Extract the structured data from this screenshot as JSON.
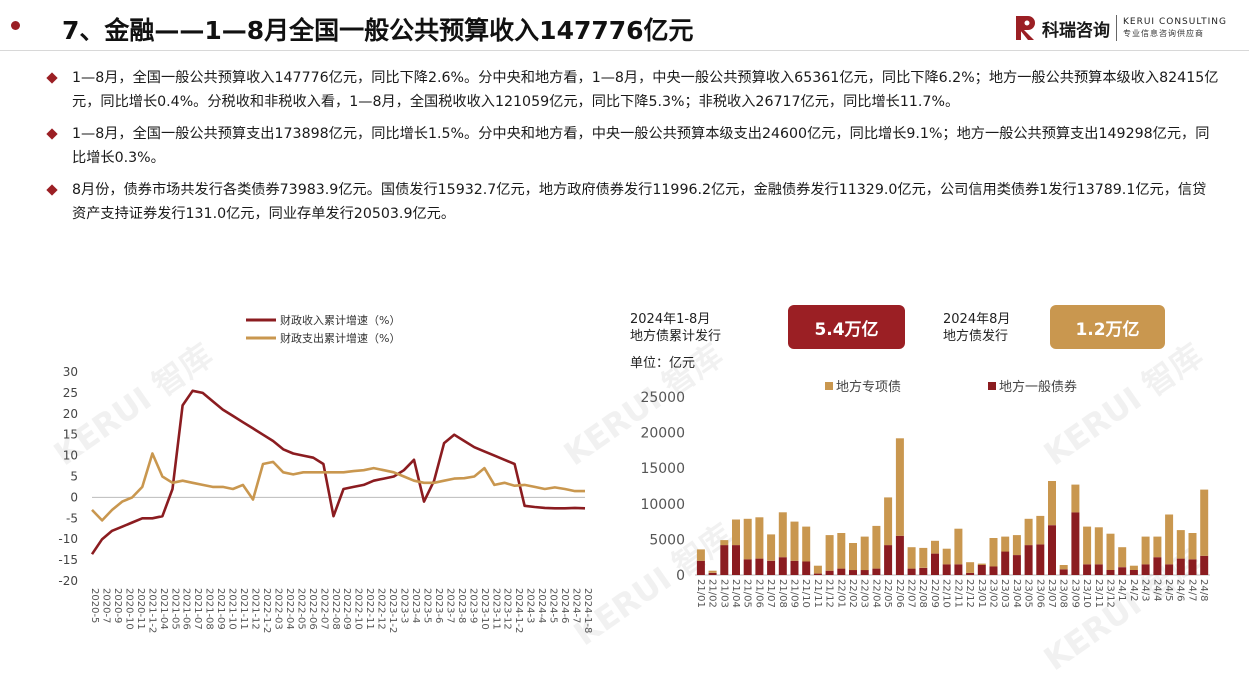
{
  "page": {
    "title": "7、金融——1—8月全国一般公共预算收入147776亿元"
  },
  "logo": {
    "name_cn": "科瑞咨询",
    "name_en": "KERUI CONSULTING",
    "tagline": "专业信息咨询供应商"
  },
  "watermark": {
    "text": "KERUI 智库"
  },
  "bullets": [
    "1—8月，全国一般公共预算收入147776亿元，同比下降2.6%。分中央和地方看，1—8月，中央一般公共预算收入65361亿元，同比下降6.2%；地方一般公共预算本级收入82415亿元，同比增长0.4%。分税收和非税收入看，1—8月，全国税收收入121059亿元，同比下降5.3%；非税收入26717亿元，同比增长11.7%。",
    "1—8月，全国一般公共预算支出173898亿元，同比增长1.5%。分中央和地方看，中央一般公共预算本级支出24600亿元，同比增长9.1%；地方一般公共预算支出149298亿元，同比增长0.3%。",
    "8月份，债券市场共发行各类债券73983.9亿元。国债发行15932.7亿元，地方政府债券发行11996.2亿元，金融债券发行11329.0亿元，公司信用类债券1发行13789.1亿元，信贷资产支持证券发行131.0亿元，同业存单发行20503.9亿元。"
  ],
  "stats": {
    "cumulative_label_line1": "2024年1-8月",
    "cumulative_label_line2": "地方债累计发行",
    "cumulative_value": "5.4万亿",
    "monthly_label_line1": "2024年8月",
    "monthly_label_line2": "地方债发行",
    "monthly_value": "1.2万亿",
    "unit_label": "单位：亿元"
  },
  "colors": {
    "dark_red": "#8b1c20",
    "gold": "#c9974f",
    "badge_red": "#9b1f24",
    "badge_gold": "#c9974f"
  },
  "chart_data": [
    {
      "type": "line",
      "title": "",
      "xlabel": "",
      "ylabel": "",
      "ylim": [
        -20,
        30
      ],
      "yticks": [
        -20,
        -15,
        -10,
        -5,
        0,
        5,
        10,
        15,
        20,
        25,
        30
      ],
      "legend_position": "top",
      "x_tick_labels": [
        "2020-5",
        "2020-7",
        "2020-9",
        "2020-10",
        "2020-11",
        "2021-1-2",
        "2021-04",
        "2021-05",
        "2021-06",
        "2021-07",
        "2021-08",
        "2021-09",
        "2021-10",
        "2021-11",
        "2021-12",
        "2022-1-2",
        "2022-03",
        "2022-04",
        "2022-05",
        "2022-06",
        "2022-07",
        "2022-08",
        "2022-09",
        "2022-10",
        "2022-11",
        "2022-12",
        "2023-1-2",
        "2023-3",
        "2023-4",
        "2023-5",
        "2023-6",
        "2023-7",
        "2023-8",
        "2023-9",
        "2023-10",
        "2023-11",
        "2023-12",
        "2024-1-2",
        "2024-3",
        "2024-4",
        "2024-5",
        "2024-6",
        "2024-7",
        "2024-1-8"
      ],
      "series": [
        {
          "name": "财政收入累计增速（%）",
          "color": "#8b1c20",
          "values": [
            -13.6,
            -10.0,
            -8.0,
            -7.0,
            -6.0,
            -5.0,
            -5.0,
            -4.5,
            2.0,
            22.0,
            25.5,
            25.0,
            23.0,
            21.0,
            19.5,
            18.0,
            16.5,
            15.0,
            13.5,
            11.5,
            10.5,
            10.0,
            9.5,
            8.0,
            -4.5,
            2.0,
            2.5,
            3.0,
            4.0,
            4.5,
            5.0,
            6.5,
            9.0,
            -1.0,
            4.0,
            13.0,
            15.0,
            13.5,
            12.0,
            11.0,
            10.0,
            9.0,
            8.0,
            -2.0,
            -2.3,
            -2.5,
            -2.6,
            -2.6,
            -2.5,
            -2.6
          ],
          "x_index": [
            0,
            1,
            2,
            3,
            4,
            5,
            6,
            7,
            8,
            9,
            10,
            11,
            12,
            13,
            14,
            15,
            16,
            17,
            18,
            19,
            20,
            21,
            22,
            23,
            24,
            25,
            26,
            27,
            28,
            29,
            30,
            31,
            32,
            33,
            34,
            35,
            36,
            37,
            38,
            39,
            40,
            41,
            42,
            43,
            44,
            45,
            46,
            47,
            48,
            49
          ]
        },
        {
          "name": "财政支出累计增速（%）",
          "color": "#c9974f",
          "values": [
            -3.0,
            -5.5,
            -3.0,
            -1.0,
            0.0,
            2.5,
            10.5,
            5.0,
            3.5,
            4.0,
            3.5,
            3.0,
            2.5,
            2.5,
            2.0,
            3.0,
            -0.5,
            8.0,
            8.5,
            6.0,
            5.5,
            6.0,
            6.0,
            6.0,
            6.0,
            6.0,
            6.3,
            6.5,
            7.0,
            6.5,
            6.0,
            5.0,
            4.0,
            3.5,
            3.5,
            4.0,
            4.5,
            4.6,
            5.0,
            7.0,
            3.0,
            3.5,
            2.8,
            3.0,
            2.5,
            2.0,
            2.4,
            2.0,
            1.5,
            1.5
          ],
          "x_index": [
            0,
            1,
            2,
            3,
            4,
            5,
            6,
            7,
            8,
            9,
            10,
            11,
            12,
            13,
            14,
            15,
            16,
            17,
            18,
            19,
            20,
            21,
            22,
            23,
            24,
            25,
            26,
            27,
            28,
            29,
            30,
            31,
            32,
            33,
            34,
            35,
            36,
            37,
            38,
            39,
            40,
            41,
            42,
            43,
            44,
            45,
            46,
            47,
            48,
            49
          ]
        }
      ]
    },
    {
      "type": "bar",
      "stacked": true,
      "title": "",
      "ylabel": "单位：亿元",
      "ylim": [
        0,
        25000
      ],
      "yticks": [
        0,
        5000,
        10000,
        15000,
        20000,
        25000
      ],
      "legend_position": "top",
      "categories": [
        "2101",
        "2102",
        "2103",
        "2104",
        "2105",
        "2106",
        "2107",
        "2108",
        "2109",
        "2110",
        "2111",
        "2112",
        "2201",
        "2202",
        "2203",
        "2204",
        "2205",
        "2206",
        "2207",
        "2208",
        "2209",
        "2210",
        "2211",
        "2212",
        "2301",
        "2302",
        "2303",
        "2304",
        "2305",
        "2306",
        "2307",
        "2308",
        "2309",
        "2310",
        "2311",
        "2312",
        "2401",
        "2402",
        "2403",
        "2404",
        "2405",
        "2406",
        "2407",
        "2408"
      ],
      "category_tick_labels": [
        "21/01",
        "21/02",
        "21/03",
        "21/04",
        "21/05",
        "21/06",
        "21/07",
        "21/08",
        "21/09",
        "21/10",
        "21/11",
        "21/12",
        "22/01",
        "22/02",
        "22/03",
        "22/04",
        "22/05",
        "22/06",
        "22/07",
        "22/08",
        "22/09",
        "22/10",
        "22/11",
        "22/12",
        "23/01",
        "23/02",
        "23/03",
        "23/04",
        "23/05",
        "23/06",
        "23/07",
        "23/08",
        "23/09",
        "23/10",
        "23/11",
        "23/12",
        "24/1",
        "24/2",
        "24/3",
        "24/4",
        "24/5",
        "24/6",
        "24/7",
        "24/8"
      ],
      "series": [
        {
          "name": "地方一般债券",
          "color": "#8b1c20",
          "values": [
            2000,
            300,
            4200,
            4200,
            2200,
            2300,
            2000,
            2500,
            2000,
            1900,
            200,
            600,
            900,
            700,
            700,
            900,
            4200,
            5500,
            900,
            1000,
            3000,
            1500,
            1500,
            300,
            1400,
            1200,
            3300,
            2800,
            4200,
            4300,
            7000,
            800,
            8800,
            1500,
            1500,
            700,
            1100,
            700,
            1500,
            2500,
            1500,
            2300,
            2200,
            2700
          ]
        },
        {
          "name": "地方专项债",
          "color": "#c9974f",
          "values": [
            1600,
            300,
            700,
            3600,
            5700,
            5800,
            3700,
            6300,
            5500,
            4900,
            1100,
            5000,
            5000,
            3800,
            4700,
            6000,
            6700,
            13700,
            3000,
            2800,
            1800,
            2200,
            5000,
            1500,
            200,
            4000,
            2100,
            2800,
            3700,
            4000,
            6200,
            600,
            3900,
            5300,
            5200,
            5100,
            2800,
            600,
            3900,
            2900,
            7000,
            4000,
            3700,
            9300
          ]
        }
      ]
    }
  ]
}
